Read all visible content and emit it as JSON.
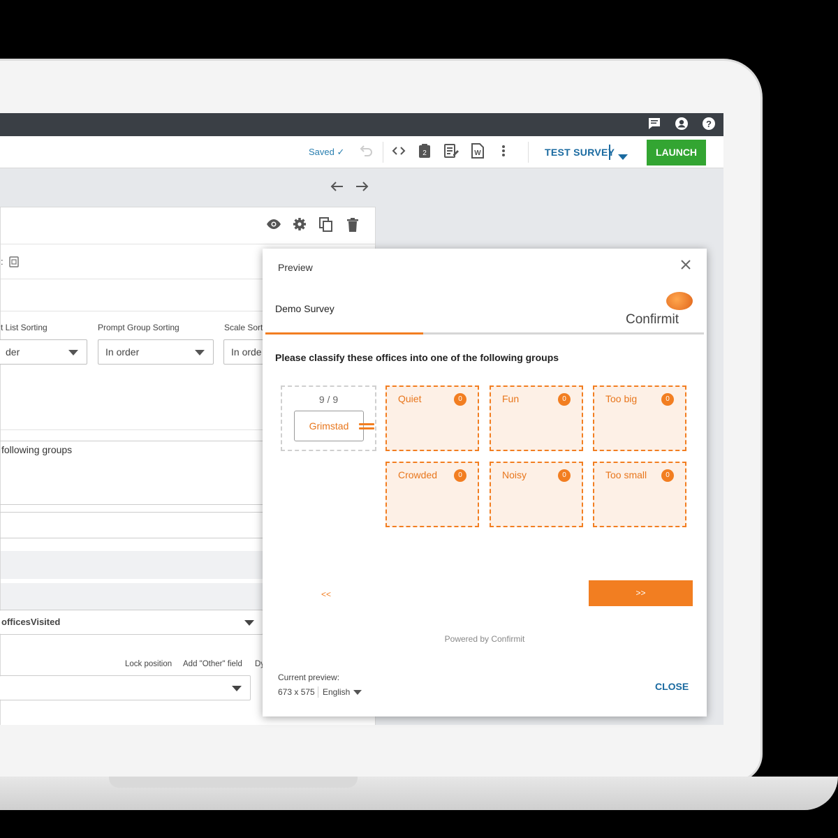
{
  "topbar": {
    "icons": [
      "chat-icon",
      "account-icon",
      "help-icon"
    ]
  },
  "toolbar": {
    "saved_label": "Saved ✓",
    "test_survey_label": "TEST SURVEY",
    "launch_label": "LAUNCH"
  },
  "editor": {
    "labels": {
      "list_sorting": "t List Sorting",
      "prompt_group_sorting": "Prompt Group Sorting",
      "scale_sorting": "Scale Sort"
    },
    "selects": {
      "list_sorting": "der",
      "prompt_group_sorting": "In order",
      "scale_sorting": "In orde"
    },
    "question_text": "following groups",
    "list_select": "officesVisited",
    "option_labels": {
      "lock_position": "Lock position",
      "add_other": "Add \"Other\" field",
      "dynamic": "Dy"
    }
  },
  "preview": {
    "title": "Preview",
    "survey_name": "Demo Survey",
    "brand": "Confirmit",
    "progress_percent": 36,
    "question": "Please classify these offices into one of the following groups",
    "source_count": "9 / 9",
    "current_item": "Grimstad",
    "groups": [
      {
        "name": "Quiet",
        "count": "0"
      },
      {
        "name": "Fun",
        "count": "0"
      },
      {
        "name": "Too big",
        "count": "0"
      },
      {
        "name": "Crowded",
        "count": "0"
      },
      {
        "name": "Noisy",
        "count": "0"
      },
      {
        "name": "Too small",
        "count": "0"
      }
    ],
    "prev_label": "<<",
    "next_label": ">>",
    "powered_by": "Powered by Confirmit",
    "current_preview_label": "Current preview:",
    "size": "673 x 575",
    "language": "English",
    "close_label": "CLOSE",
    "accent_color": "#f27e21"
  }
}
